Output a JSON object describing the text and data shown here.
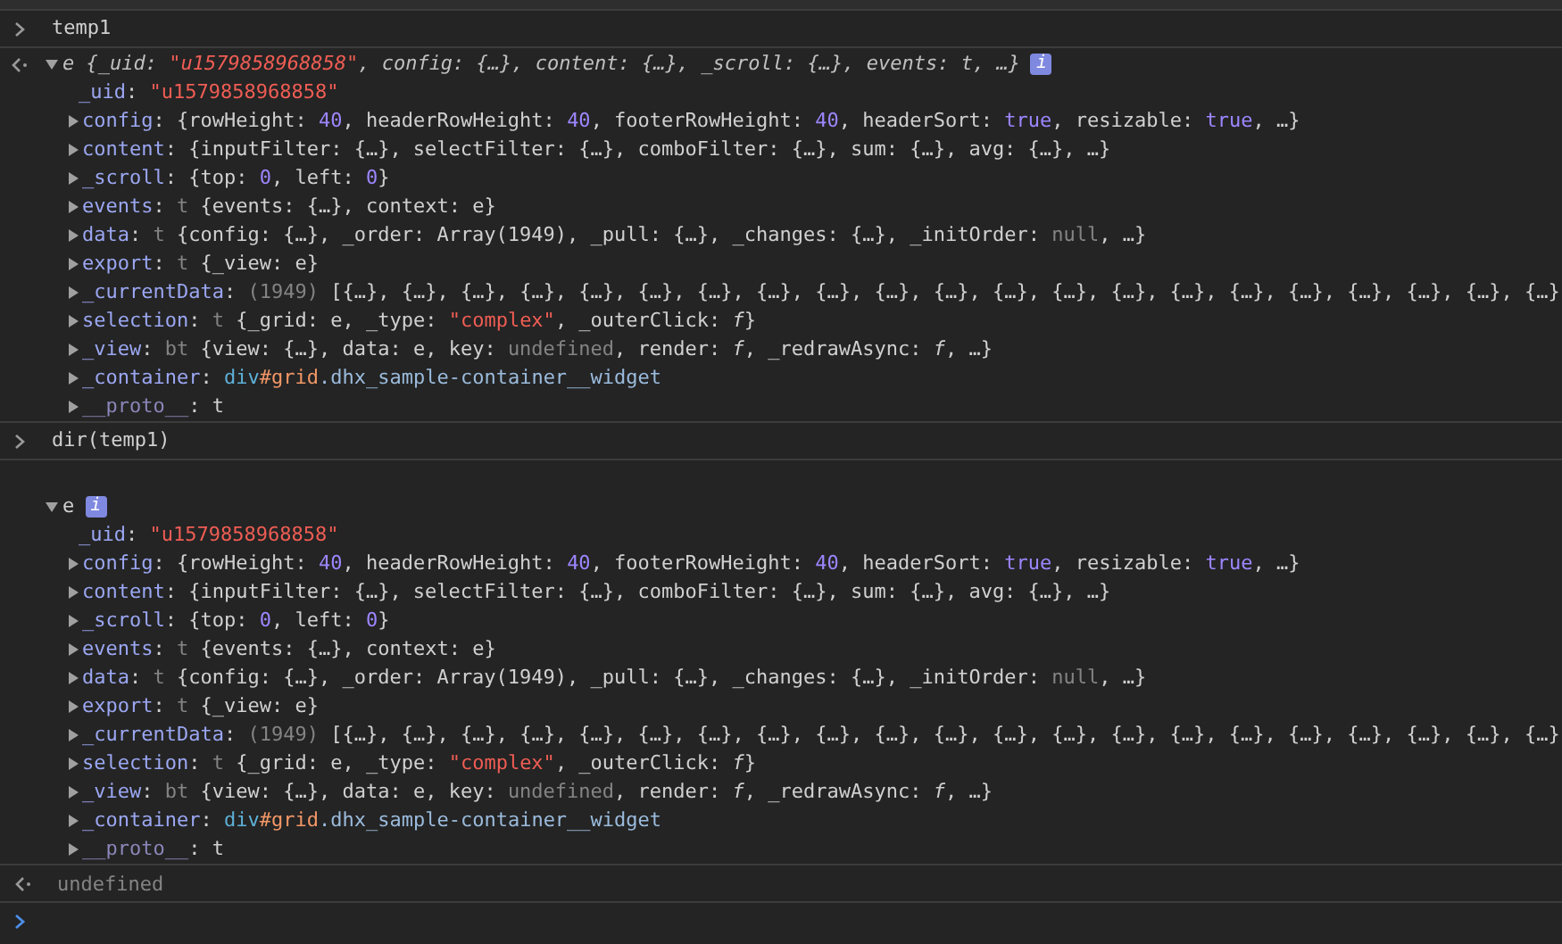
{
  "console": [
    {
      "kind": "input",
      "text": "temp1"
    },
    {
      "kind": "result",
      "expanded": true,
      "header": [
        {
          "kind": "label",
          "text": "e"
        },
        {
          "kind": "text",
          "text": " {_uid: "
        },
        {
          "kind": "str",
          "text": "\"u1579858968858\""
        },
        {
          "kind": "text",
          "text": ", config: {…}, content: {…}, _scroll: {…}, events: t, …}"
        }
      ],
      "badge": "i",
      "properties": [
        {
          "tokens": [
            {
              "kind": "key",
              "text": "_uid"
            },
            {
              "kind": "text",
              "text": ": "
            },
            {
              "kind": "str",
              "text": "\"u1579858968858\""
            }
          ]
        },
        {
          "expanded": false,
          "tokens": [
            {
              "kind": "key",
              "text": "config"
            },
            {
              "kind": "text",
              "text": ": {rowHeight: "
            },
            {
              "kind": "num",
              "text": "40"
            },
            {
              "kind": "text",
              "text": ", headerRowHeight: "
            },
            {
              "kind": "num",
              "text": "40"
            },
            {
              "kind": "text",
              "text": ", footerRowHeight: "
            },
            {
              "kind": "num",
              "text": "40"
            },
            {
              "kind": "text",
              "text": ", headerSort: "
            },
            {
              "kind": "num",
              "text": "true"
            },
            {
              "kind": "text",
              "text": ", resizable: "
            },
            {
              "kind": "num",
              "text": "true"
            },
            {
              "kind": "text",
              "text": ", …}"
            }
          ]
        },
        {
          "expanded": false,
          "tokens": [
            {
              "kind": "key",
              "text": "content"
            },
            {
              "kind": "text",
              "text": ": {inputFilter: {…}, selectFilter: {…}, comboFilter: {…}, sum: {…}, avg: {…}, …}"
            }
          ]
        },
        {
          "expanded": false,
          "tokens": [
            {
              "kind": "key",
              "text": "_scroll"
            },
            {
              "kind": "text",
              "text": ": {top: "
            },
            {
              "kind": "num",
              "text": "0"
            },
            {
              "kind": "text",
              "text": ", left: "
            },
            {
              "kind": "num",
              "text": "0"
            },
            {
              "kind": "text",
              "text": "}"
            }
          ]
        },
        {
          "expanded": false,
          "tokens": [
            {
              "kind": "key",
              "text": "events"
            },
            {
              "kind": "text",
              "text": ": "
            },
            {
              "kind": "dim",
              "text": "t"
            },
            {
              "kind": "text",
              "text": " {events: {…}, context: e}"
            }
          ]
        },
        {
          "expanded": false,
          "tokens": [
            {
              "kind": "key",
              "text": "data"
            },
            {
              "kind": "text",
              "text": ": "
            },
            {
              "kind": "dim",
              "text": "t"
            },
            {
              "kind": "text",
              "text": " {config: {…}, _order: Array(1949), _pull: {…}, _changes: {…}, _initOrder: "
            },
            {
              "kind": "dim",
              "text": "null"
            },
            {
              "kind": "text",
              "text": ", …}"
            }
          ]
        },
        {
          "expanded": false,
          "tokens": [
            {
              "kind": "key",
              "text": "export"
            },
            {
              "kind": "text",
              "text": ": "
            },
            {
              "kind": "dim",
              "text": "t"
            },
            {
              "kind": "text",
              "text": " {_view: e}"
            }
          ]
        },
        {
          "expanded": false,
          "tokens": [
            {
              "kind": "key",
              "text": "_currentData"
            },
            {
              "kind": "text",
              "text": ": "
            },
            {
              "kind": "dim",
              "text": "(1949)"
            },
            {
              "kind": "text",
              "text": " [{…}, {…}, {…}, {…}, {…}, {…}, {…}, {…}, {…}, {…}, {…}, {…}, {…}, {…}, {…}, {…}, {…}, {…}, {…}, {…}, {…}"
            }
          ]
        },
        {
          "expanded": false,
          "tokens": [
            {
              "kind": "key",
              "text": "selection"
            },
            {
              "kind": "text",
              "text": ": "
            },
            {
              "kind": "dim",
              "text": "t"
            },
            {
              "kind": "text",
              "text": " {_grid: e, _type: "
            },
            {
              "kind": "str",
              "text": "\"complex\""
            },
            {
              "kind": "text",
              "text": ", _outerClick: "
            },
            {
              "kind": "fn",
              "text": "f"
            },
            {
              "kind": "text",
              "text": "}"
            }
          ]
        },
        {
          "expanded": false,
          "tokens": [
            {
              "kind": "key",
              "text": "_view"
            },
            {
              "kind": "text",
              "text": ": "
            },
            {
              "kind": "dim",
              "text": "bt"
            },
            {
              "kind": "text",
              "text": " {view: {…}, data: e, key: "
            },
            {
              "kind": "dim",
              "text": "undefined"
            },
            {
              "kind": "text",
              "text": ", render: "
            },
            {
              "kind": "fn",
              "text": "f"
            },
            {
              "kind": "text",
              "text": ", _redrawAsync: "
            },
            {
              "kind": "fn",
              "text": "f"
            },
            {
              "kind": "text",
              "text": ", …}"
            }
          ]
        },
        {
          "expanded": false,
          "tokens": [
            {
              "kind": "key",
              "text": "_container"
            },
            {
              "kind": "text",
              "text": ": "
            },
            {
              "kind": "tag",
              "text": "div"
            },
            {
              "kind": "id",
              "text": "#grid"
            },
            {
              "kind": "cls",
              "text": ".dhx_sample-container__widget"
            }
          ]
        },
        {
          "expanded": false,
          "tokens": [
            {
              "kind": "dimkey",
              "text": "__proto__"
            },
            {
              "kind": "text",
              "text": ": t"
            }
          ]
        }
      ]
    },
    {
      "kind": "input",
      "text": "dir(temp1)"
    },
    {
      "kind": "object",
      "expanded": true,
      "header": [
        {
          "kind": "text",
          "text": "e"
        }
      ],
      "badge": "i",
      "properties": [
        {
          "tokens": [
            {
              "kind": "key",
              "text": "_uid"
            },
            {
              "kind": "text",
              "text": ": "
            },
            {
              "kind": "str",
              "text": "\"u1579858968858\""
            }
          ]
        },
        {
          "expanded": false,
          "tokens": [
            {
              "kind": "key",
              "text": "config"
            },
            {
              "kind": "text",
              "text": ": {rowHeight: "
            },
            {
              "kind": "num",
              "text": "40"
            },
            {
              "kind": "text",
              "text": ", headerRowHeight: "
            },
            {
              "kind": "num",
              "text": "40"
            },
            {
              "kind": "text",
              "text": ", footerRowHeight: "
            },
            {
              "kind": "num",
              "text": "40"
            },
            {
              "kind": "text",
              "text": ", headerSort: "
            },
            {
              "kind": "num",
              "text": "true"
            },
            {
              "kind": "text",
              "text": ", resizable: "
            },
            {
              "kind": "num",
              "text": "true"
            },
            {
              "kind": "text",
              "text": ", …}"
            }
          ]
        },
        {
          "expanded": false,
          "tokens": [
            {
              "kind": "key",
              "text": "content"
            },
            {
              "kind": "text",
              "text": ": {inputFilter: {…}, selectFilter: {…}, comboFilter: {…}, sum: {…}, avg: {…}, …}"
            }
          ]
        },
        {
          "expanded": false,
          "tokens": [
            {
              "kind": "key",
              "text": "_scroll"
            },
            {
              "kind": "text",
              "text": ": {top: "
            },
            {
              "kind": "num",
              "text": "0"
            },
            {
              "kind": "text",
              "text": ", left: "
            },
            {
              "kind": "num",
              "text": "0"
            },
            {
              "kind": "text",
              "text": "}"
            }
          ]
        },
        {
          "expanded": false,
          "tokens": [
            {
              "kind": "key",
              "text": "events"
            },
            {
              "kind": "text",
              "text": ": "
            },
            {
              "kind": "dim",
              "text": "t"
            },
            {
              "kind": "text",
              "text": " {events: {…}, context: e}"
            }
          ]
        },
        {
          "expanded": false,
          "tokens": [
            {
              "kind": "key",
              "text": "data"
            },
            {
              "kind": "text",
              "text": ": "
            },
            {
              "kind": "dim",
              "text": "t"
            },
            {
              "kind": "text",
              "text": " {config: {…}, _order: Array(1949), _pull: {…}, _changes: {…}, _initOrder: "
            },
            {
              "kind": "dim",
              "text": "null"
            },
            {
              "kind": "text",
              "text": ", …}"
            }
          ]
        },
        {
          "expanded": false,
          "tokens": [
            {
              "kind": "key",
              "text": "export"
            },
            {
              "kind": "text",
              "text": ": "
            },
            {
              "kind": "dim",
              "text": "t"
            },
            {
              "kind": "text",
              "text": " {_view: e}"
            }
          ]
        },
        {
          "expanded": false,
          "tokens": [
            {
              "kind": "key",
              "text": "_currentData"
            },
            {
              "kind": "text",
              "text": ": "
            },
            {
              "kind": "dim",
              "text": "(1949)"
            },
            {
              "kind": "text",
              "text": " [{…}, {…}, {…}, {…}, {…}, {…}, {…}, {…}, {…}, {…}, {…}, {…}, {…}, {…}, {…}, {…}, {…}, {…}, {…}, {…}, {…}"
            }
          ]
        },
        {
          "expanded": false,
          "tokens": [
            {
              "kind": "key",
              "text": "selection"
            },
            {
              "kind": "text",
              "text": ": "
            },
            {
              "kind": "dim",
              "text": "t"
            },
            {
              "kind": "text",
              "text": " {_grid: e, _type: "
            },
            {
              "kind": "str",
              "text": "\"complex\""
            },
            {
              "kind": "text",
              "text": ", _outerClick: "
            },
            {
              "kind": "fn",
              "text": "f"
            },
            {
              "kind": "text",
              "text": "}"
            }
          ]
        },
        {
          "expanded": false,
          "tokens": [
            {
              "kind": "key",
              "text": "_view"
            },
            {
              "kind": "text",
              "text": ": "
            },
            {
              "kind": "dim",
              "text": "bt"
            },
            {
              "kind": "text",
              "text": " {view: {…}, data: e, key: "
            },
            {
              "kind": "dim",
              "text": "undefined"
            },
            {
              "kind": "text",
              "text": ", render: "
            },
            {
              "kind": "fn",
              "text": "f"
            },
            {
              "kind": "text",
              "text": ", _redrawAsync: "
            },
            {
              "kind": "fn",
              "text": "f"
            },
            {
              "kind": "text",
              "text": ", …}"
            }
          ]
        },
        {
          "expanded": false,
          "tokens": [
            {
              "kind": "key",
              "text": "_container"
            },
            {
              "kind": "text",
              "text": ": "
            },
            {
              "kind": "tag",
              "text": "div"
            },
            {
              "kind": "id",
              "text": "#grid"
            },
            {
              "kind": "cls",
              "text": ".dhx_sample-container__widget"
            }
          ]
        },
        {
          "expanded": false,
          "tokens": [
            {
              "kind": "dimkey",
              "text": "__proto__"
            },
            {
              "kind": "text",
              "text": ": t"
            }
          ]
        }
      ]
    },
    {
      "kind": "return",
      "text": "undefined"
    }
  ]
}
